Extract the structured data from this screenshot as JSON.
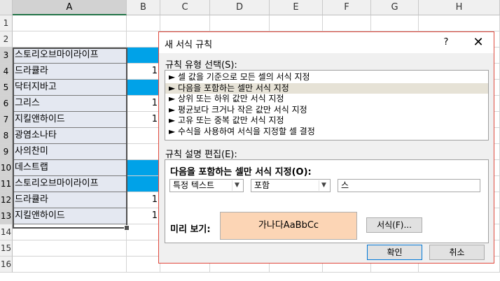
{
  "sheet": {
    "columns": [
      "A",
      "B",
      "C",
      "D",
      "E",
      "F",
      "G",
      "H"
    ],
    "rows": [
      "1",
      "2",
      "3",
      "4",
      "5",
      "6",
      "7",
      "8",
      "9",
      "10",
      "11",
      "12",
      "13",
      "14",
      "15",
      "16"
    ],
    "col_a": [
      "",
      "",
      "스토리오브마이라이프",
      "드라큘라",
      "닥터지바고",
      "그리스",
      "지킬앤하이드",
      "광염소나타",
      "사의찬미",
      "데스트랩",
      "스토리오브마이라이프",
      "드라큘라",
      "지킬앤하이드",
      "",
      "",
      ""
    ],
    "col_b": [
      "",
      "",
      "",
      "1",
      "",
      "1",
      "1",
      "",
      "",
      "",
      "",
      "1",
      "1",
      "",
      "",
      ""
    ],
    "col_b_blue": [
      false,
      false,
      true,
      false,
      true,
      false,
      false,
      false,
      false,
      true,
      true,
      false,
      false,
      false,
      false,
      false
    ],
    "highlight_color": "#00a2e8",
    "selection": "A3:A13"
  },
  "dialog": {
    "title": "새 서식 규칙",
    "help": "?",
    "close": "✕",
    "type_label": "규칙 유형 선택(S):",
    "rule_types": [
      "► 셀 값을 기준으로 모든 셀의 서식 지정",
      "► 다음을 포함하는 셀만 서식 지정",
      "► 상위 또는 하위 값만 서식 지정",
      "► 평균보다 크거나 작은 값만 서식 지정",
      "► 고유 또는 중복 값만 서식 지정",
      "► 수식을 사용하여 서식을 지정할 셀 결정"
    ],
    "selected_rule_index": 1,
    "edit_label": "규칙 설명 편집(E):",
    "desc_title": "다음을 포함하는 셀만 서식 지정(O):",
    "combo1": "특정 텍스트",
    "combo2": "포함",
    "text_value": "스",
    "preview_label": "미리 보기:",
    "preview_text": "가나다AaBbCc",
    "preview_color": "#fcd5b5",
    "format_button": "서식(F)...",
    "ok_button": "확인",
    "cancel_button": "취소"
  }
}
